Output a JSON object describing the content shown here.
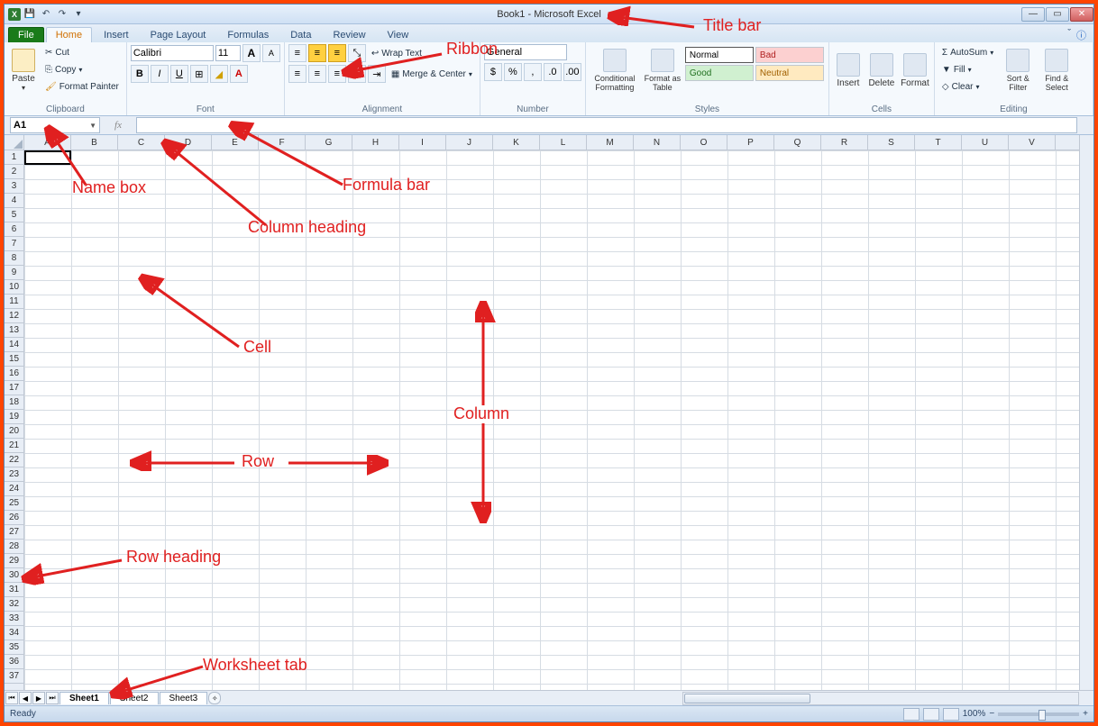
{
  "title": "Book1 - Microsoft Excel",
  "qat": {
    "save": "💾",
    "undo": "↶",
    "redo": "↷"
  },
  "tabs": {
    "file": "File",
    "list": [
      "Home",
      "Insert",
      "Page Layout",
      "Formulas",
      "Data",
      "Review",
      "View"
    ],
    "active": "Home"
  },
  "ribbon": {
    "clipboard": {
      "paste": "Paste",
      "cut": "Cut",
      "copy": "Copy",
      "fmt": "Format Painter",
      "label": "Clipboard"
    },
    "font": {
      "name": "Calibri",
      "size": "11",
      "bold": "B",
      "italic": "I",
      "underline": "U",
      "grow": "A",
      "shrink": "A",
      "label": "Font"
    },
    "align": {
      "wrap": "Wrap Text",
      "merge": "Merge & Center",
      "label": "Alignment"
    },
    "number": {
      "fmt": "General",
      "label": "Number"
    },
    "styles": {
      "cond": "Conditional Formatting",
      "table": "Format as Table",
      "normal": "Normal",
      "bad": "Bad",
      "good": "Good",
      "neutral": "Neutral",
      "label": "Styles"
    },
    "cells": {
      "insert": "Insert",
      "delete": "Delete",
      "format": "Format",
      "label": "Cells"
    },
    "editing": {
      "sum": "AutoSum",
      "fill": "Fill",
      "clear": "Clear",
      "sort": "Sort & Filter",
      "find": "Find & Select",
      "label": "Editing"
    }
  },
  "namebox": "A1",
  "columns": [
    "A",
    "B",
    "C",
    "D",
    "E",
    "F",
    "G",
    "H",
    "I",
    "J",
    "K",
    "L",
    "M",
    "N",
    "O",
    "P",
    "Q",
    "R",
    "S",
    "T",
    "U",
    "V"
  ],
  "rows": [
    "1",
    "2",
    "3",
    "4",
    "5",
    "6",
    "7",
    "8",
    "9",
    "10",
    "11",
    "12",
    "13",
    "14",
    "15",
    "16",
    "17",
    "18",
    "19",
    "20",
    "21",
    "22",
    "23",
    "24",
    "25",
    "26",
    "27",
    "28",
    "29",
    "30",
    "31",
    "32",
    "33",
    "34",
    "35",
    "36",
    "37"
  ],
  "sheets": {
    "list": [
      "Sheet1",
      "Sheet2",
      "Sheet3"
    ],
    "active": "Sheet1"
  },
  "status": {
    "ready": "Ready",
    "zoom": "100%"
  },
  "annotations": {
    "title_bar": "Title bar",
    "ribbon": "Ribbon",
    "name_box": "Name box",
    "formula_bar": "Formula bar",
    "column_heading": "Column heading",
    "cell": "Cell",
    "row": "Row",
    "column": "Column",
    "row_heading": "Row heading",
    "worksheet_tab": "Worksheet tab"
  }
}
